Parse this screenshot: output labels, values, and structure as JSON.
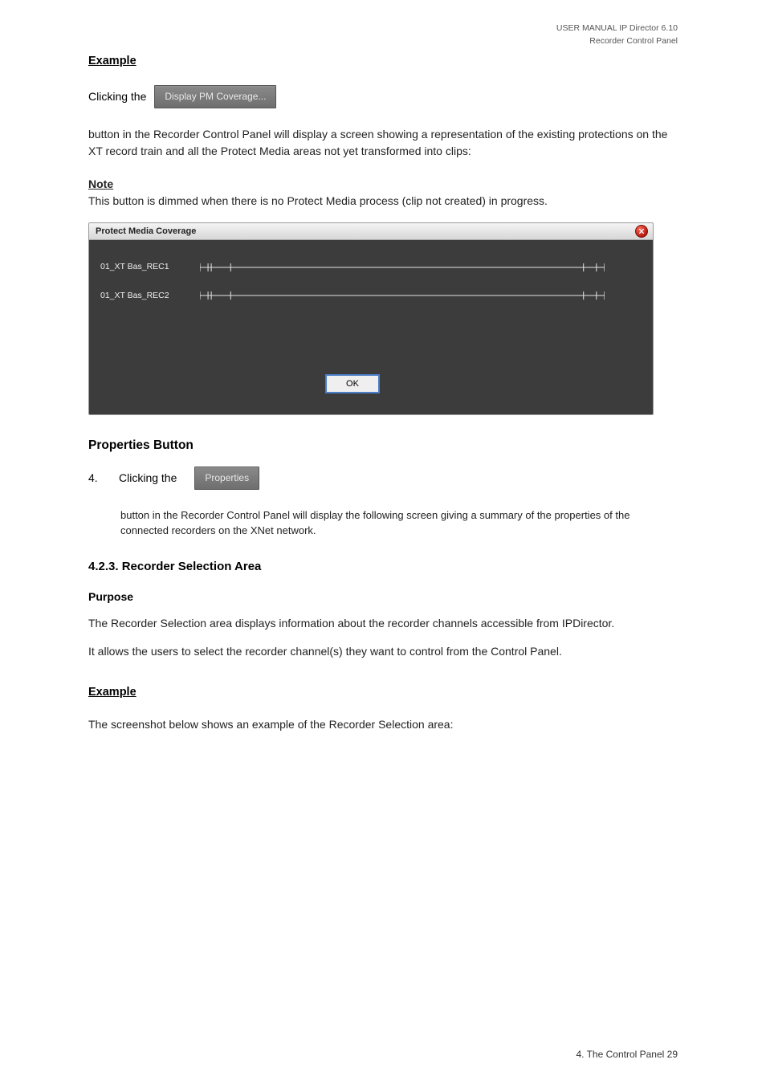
{
  "header": {
    "line1": "USER MANUAL IP Director 6.10",
    "line2": "Recorder Control Panel"
  },
  "section1": {
    "heading": "Example",
    "para1_before": "Clicking the",
    "btn1": "Display PM Coverage...",
    "para1_after": "button in the Recorder Control Panel will display a screen showing a representation of the existing protections on the XT record train and all the Protect Media areas not yet transformed into clips:",
    "note_label": "Note",
    "note_text": "This button is dimmed when there is no Protect Media process (clip not created) in progress."
  },
  "dialog": {
    "title": "Protect Media Coverage",
    "rows": [
      {
        "label": "01_XT Bas_REC1"
      },
      {
        "label": "01_XT Bas_REC2"
      }
    ],
    "ok": "OK"
  },
  "section2": {
    "heading": "Properties Button",
    "num": "4.",
    "line_before": "Clicking the",
    "btn": "Properties",
    "line_after": "button in the Recorder Control Panel will display the following screen giving a summary of the properties of the connected recorders on the XNet network."
  },
  "section3": {
    "heading": "4.2.3.   Recorder Selection Area",
    "h4": "Purpose",
    "para1": "The Recorder Selection area displays information about the recorder channels accessible from IPDirector.",
    "para2": "It allows the users to select the recorder channel(s) they want to control from the Control Panel."
  },
  "section4": {
    "subheading": "Example",
    "para": "The screenshot below shows an example of the Recorder Selection area:"
  },
  "footer": {
    "text": "4. The Control Panel        29"
  }
}
